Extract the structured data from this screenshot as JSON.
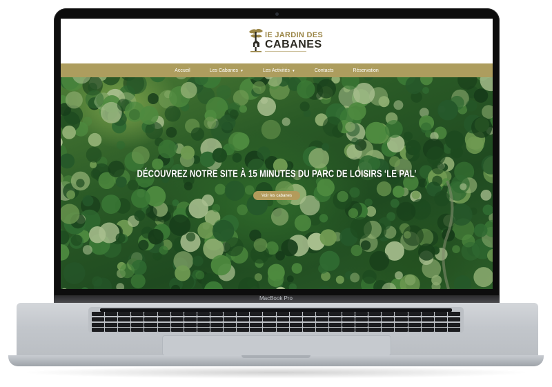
{
  "site": {
    "logo": {
      "line1": "lE JARDIN DES",
      "line2": "CABANES"
    },
    "nav": {
      "items": [
        {
          "label": "Accueil",
          "has_dropdown": false
        },
        {
          "label": "Les Cabanes",
          "has_dropdown": true
        },
        {
          "label": "Les Activités",
          "has_dropdown": true
        },
        {
          "label": "Contacts",
          "has_dropdown": false
        },
        {
          "label": "Réservation",
          "has_dropdown": false
        }
      ],
      "background": "#ad9d5e"
    },
    "hero": {
      "title": "DÉCOUVREZ NOTRE SITE À 15 MINUTES DU PARC DE LOISIRS ‘LE PAL’",
      "button_label": "Voir les cabanes",
      "button_color": "#b39b5b"
    }
  },
  "device": {
    "label": "MacBook Pro"
  },
  "colors": {
    "brand_gold": "#9a8545",
    "dark_text": "#2c2a22"
  }
}
